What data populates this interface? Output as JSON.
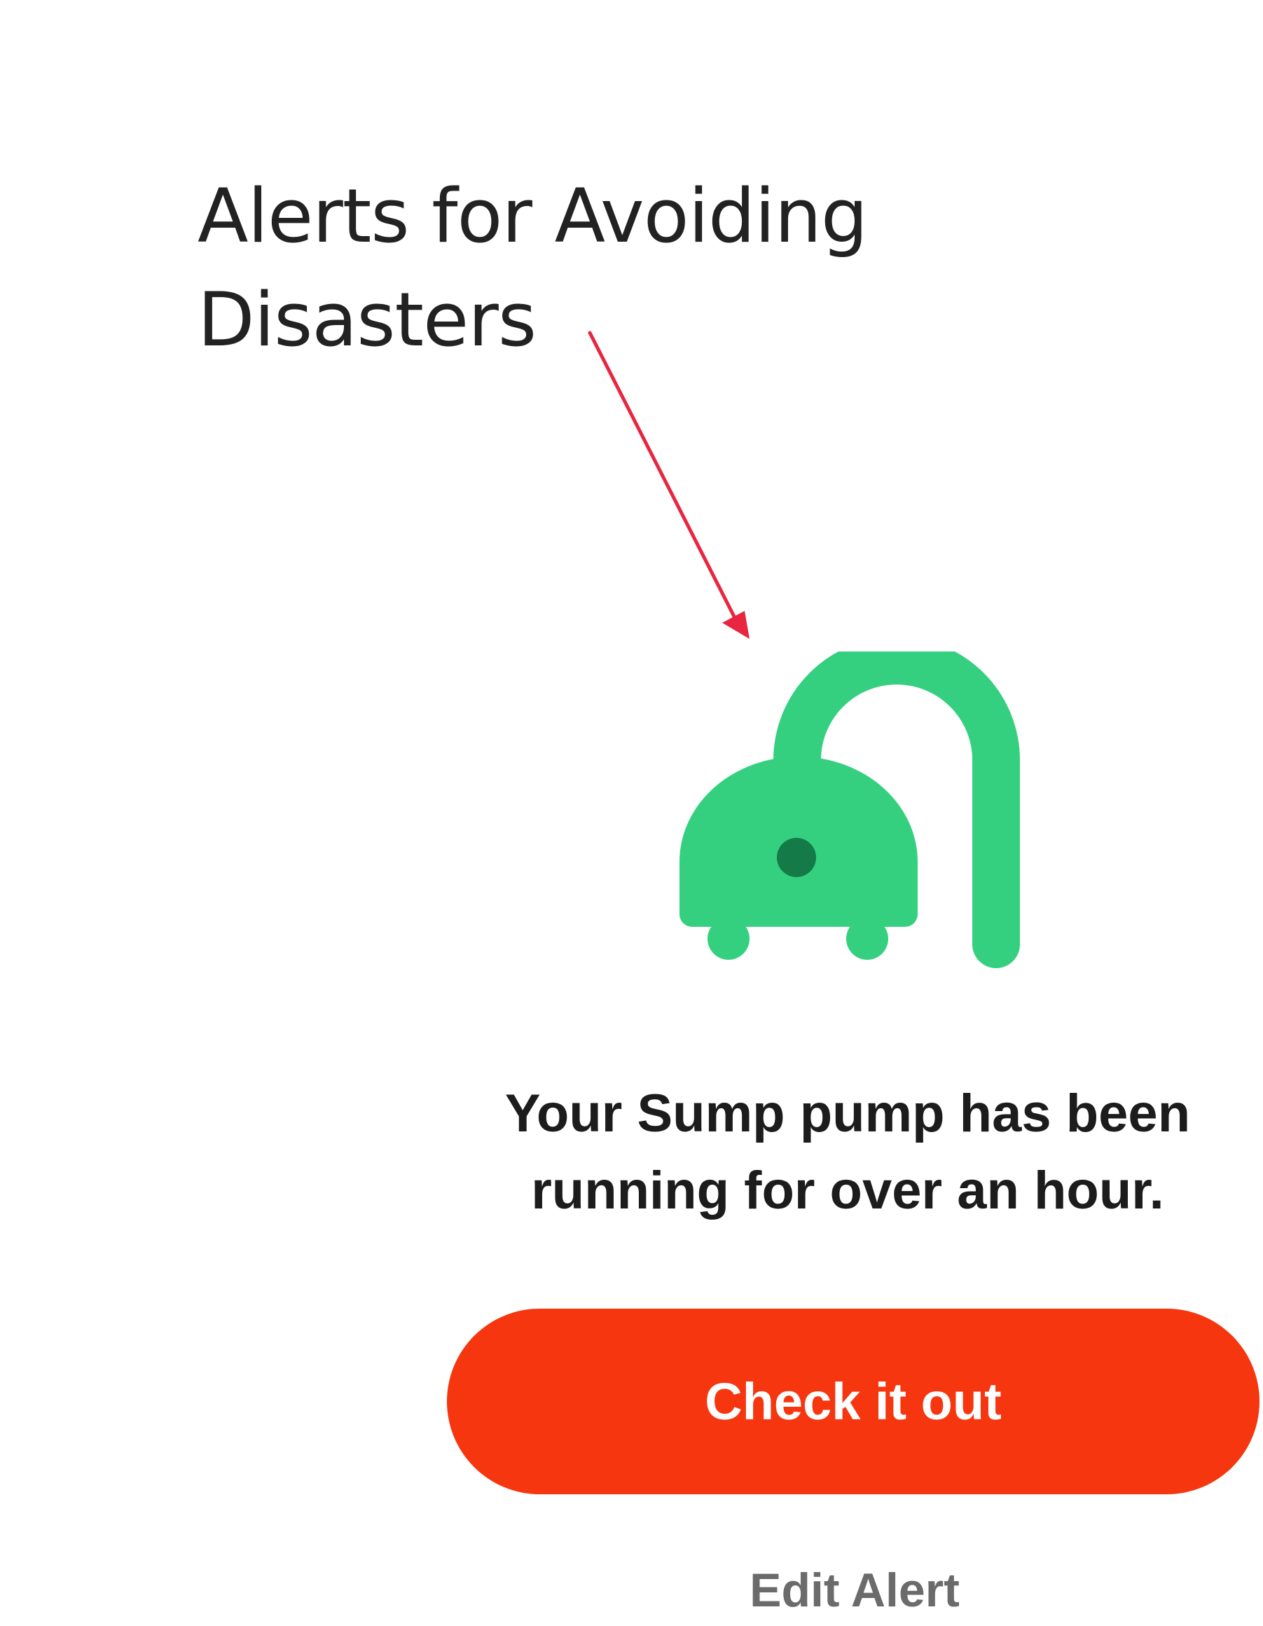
{
  "annotation": {
    "title_line1": "Alerts for Avoiding",
    "title_line2": "Disasters",
    "arrow_color": "#e8263f"
  },
  "illustration": {
    "icon": "sump-pump-icon",
    "color_main": "#35d07f",
    "color_dot": "#137a48"
  },
  "alert": {
    "message_line1": "Your Sump pump has been",
    "message_line2": "running for over an hour."
  },
  "actions": {
    "primary_label": "Check it out",
    "primary_color": "#f5360f",
    "secondary_label": "Edit Alert"
  }
}
